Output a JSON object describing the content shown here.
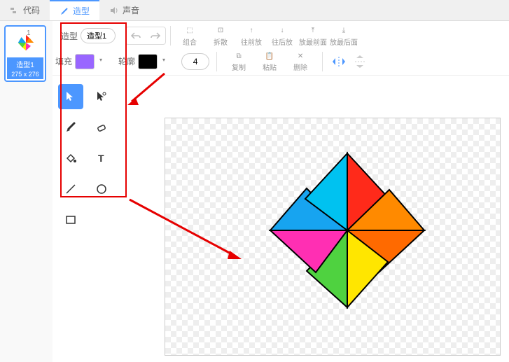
{
  "tabs": {
    "code": "代码",
    "costumes": "造型",
    "sounds": "声音"
  },
  "thumb": {
    "num": "1",
    "label": "造型1",
    "size": "275 x 276"
  },
  "name": {
    "label": "造型",
    "value": "造型1"
  },
  "actions": {
    "group": "组合",
    "ungroup": "拆散",
    "forward": "往前放",
    "backward": "往后放",
    "front": "放最前面",
    "back": "放最后面"
  },
  "second": {
    "fill_label": "填充",
    "outline_label": "轮廓",
    "fill_color": "#9966ff",
    "outline_color": "#000000",
    "stroke_width": "4",
    "copy": "复制",
    "paste": "粘贴",
    "delete": "删除"
  },
  "tools": {
    "select": "select",
    "reshape": "reshape",
    "brush": "brush",
    "eraser": "eraser",
    "fill": "fill",
    "text": "text",
    "line": "line",
    "circle": "circle",
    "rect": "rect"
  },
  "pinwheel_colors": {
    "red": "#ff2a1a",
    "blue": "#17a4f0",
    "magenta": "#ff2fb3",
    "orange": "#ff8a00",
    "yellow": "#ffe600",
    "cyan": "#00c2f0",
    "green": "#4fd240",
    "darkorange": "#ff6a00"
  }
}
